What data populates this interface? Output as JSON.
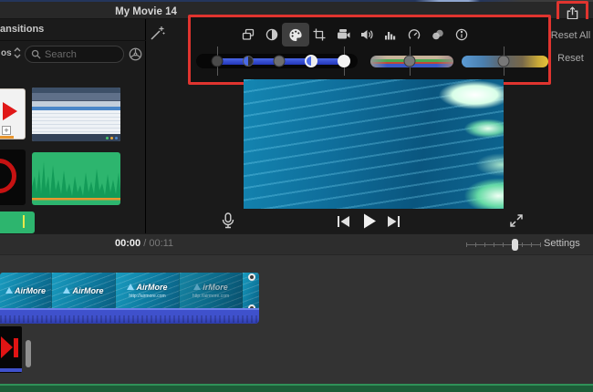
{
  "window": {
    "title": "My Movie 14"
  },
  "browser": {
    "tab_label": "ansitions",
    "media_kind_label": "os",
    "search_placeholder": "Search"
  },
  "adjust": {
    "toolbar_icons": [
      "overlay",
      "color-balance",
      "color-correction",
      "crop",
      "stabilization",
      "volume",
      "noise-reduction",
      "speed",
      "effects",
      "info"
    ],
    "selected_tool": "color-correction",
    "reset_all_label": "Reset All",
    "reset_label": "Reset"
  },
  "transport": {
    "current_time": "00:00",
    "time_separator": "/",
    "duration": "00:11",
    "settings_label": "Settings"
  },
  "timeline": {
    "clips": [
      {
        "label": "AirMore",
        "url": ""
      },
      {
        "label": "AirMore",
        "url": ""
      },
      {
        "label": "AirMore",
        "url": "http://airmore.com"
      },
      {
        "label": "irMore",
        "url": "http://airmore.com"
      }
    ]
  },
  "thumb_plus": "+",
  "colors": {
    "highlight_red": "#e0342f",
    "audio_blue": "#3f51cc",
    "clip_teal": "#0e7ba0",
    "bottom_green": "#1d5c38"
  }
}
